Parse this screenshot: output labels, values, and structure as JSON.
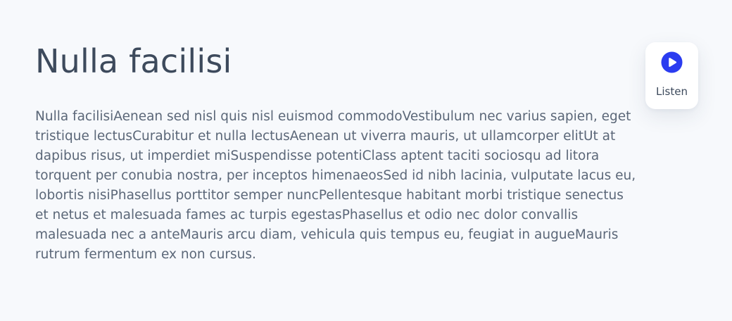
{
  "article": {
    "title": "Nulla facilisi",
    "body": "Nulla facilisiAenean sed nisl quis nisl euismod commodoVestibulum nec varius sapien, eget tristique lectusCurabitur et nulla lectusAenean ut viverra mauris, ut ullamcorper elitUt at dapibus risus, ut imperdiet miSuspendisse potentiClass aptent taciti sociosqu ad litora torquent per conubia nostra, per inceptos himenaeosSed id nibh lacinia, vulputate lacus eu, lobortis nisiPhasellus porttitor semper nuncPellentesque habitant morbi tristique senectus et netus et malesuada fames ac turpis egestasPhasellus et odio nec dolor convallis malesuada nec a anteMauris arcu diam, vehicula quis tempus eu, feugiat in augueMauris rutrum fermentum ex non cursus."
  },
  "listen_widget": {
    "label": "Listen",
    "icon": "play-circle-icon",
    "accent_color": "#2b3cf0"
  },
  "colors": {
    "background": "#f7f9fc",
    "title": "#3d4a5c",
    "body_text": "#5b6778",
    "card": "#ffffff"
  }
}
